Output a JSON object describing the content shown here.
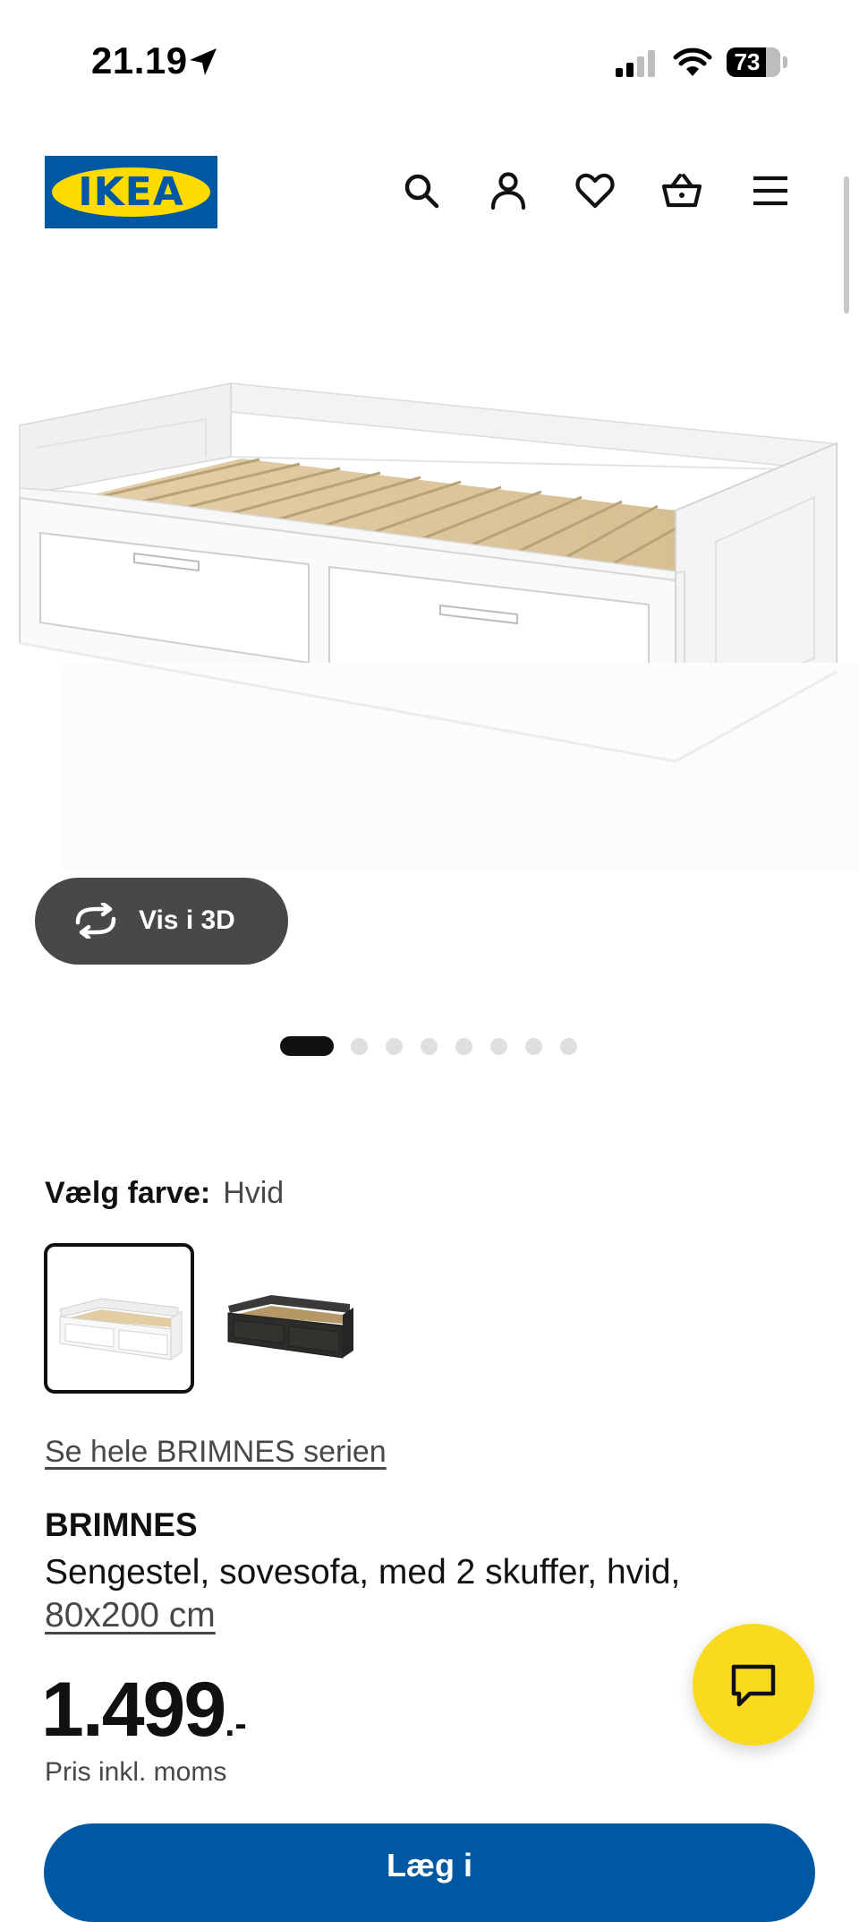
{
  "status_bar": {
    "time": "21.19",
    "battery": "73"
  },
  "header": {
    "logo_text": "IKEA",
    "icons": [
      "search-icon",
      "account-icon",
      "heart-icon",
      "basket-icon",
      "menu-icon"
    ]
  },
  "gallery": {
    "view_3d_label": "Vis i 3D",
    "slide_count": 8,
    "active_slide": 1
  },
  "color_selector": {
    "label": "Vælg farve:",
    "selected_value": "Hvid",
    "options": [
      "Hvid",
      "Sort-brun"
    ]
  },
  "series_link": "Se hele BRIMNES serien",
  "product": {
    "name": "BRIMNES",
    "description": "Sengestel, sovesofa, med 2 skuffer, hvid,",
    "size": "80x200 cm",
    "price": "1.499",
    "price_suffix": ".-",
    "price_note": "Pris inkl. moms",
    "buy_label": "Læg i"
  },
  "colors": {
    "ikea_blue": "#0058a3",
    "ikea_yellow": "#ffdb00",
    "chat_yellow": "#fada1f",
    "dark_button": "#484848"
  }
}
